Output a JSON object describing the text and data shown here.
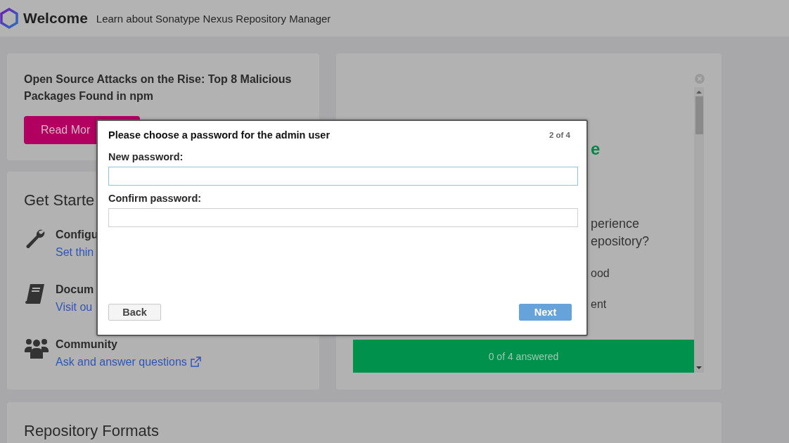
{
  "header": {
    "title": "Welcome",
    "subtitle": "Learn about Sonatype Nexus Repository Manager"
  },
  "news_card": {
    "headline": "Open Source Attacks on the Rise: Top 8 Malicious Packages Found in npm",
    "button": "Read Mor"
  },
  "get_started": {
    "title": "Get Starte",
    "items": [
      {
        "kind": "wrench",
        "title": "Configu",
        "link": "Set thin",
        "external": false
      },
      {
        "kind": "book",
        "title": "Docum",
        "link": "Visit ou",
        "external": false
      },
      {
        "kind": "people",
        "title": "Community",
        "link": "Ask and answer questions",
        "external": true
      }
    ]
  },
  "survey": {
    "heading": "e",
    "question_lines": [
      "perience",
      "epository?"
    ],
    "options": [
      "ood",
      "ent"
    ],
    "progress": "0 of 4 answered"
  },
  "repository_formats": {
    "title": "Repository Formats"
  },
  "dialog": {
    "title": "Please choose a password for the admin user",
    "step": "2 of 4",
    "fields": [
      {
        "label": "New password:",
        "focused": true
      },
      {
        "label": "Confirm password:",
        "focused": false
      }
    ],
    "buttons": [
      {
        "label": "Back",
        "kind": "secondary"
      },
      {
        "label": "Next",
        "kind": "primary"
      }
    ]
  }
}
